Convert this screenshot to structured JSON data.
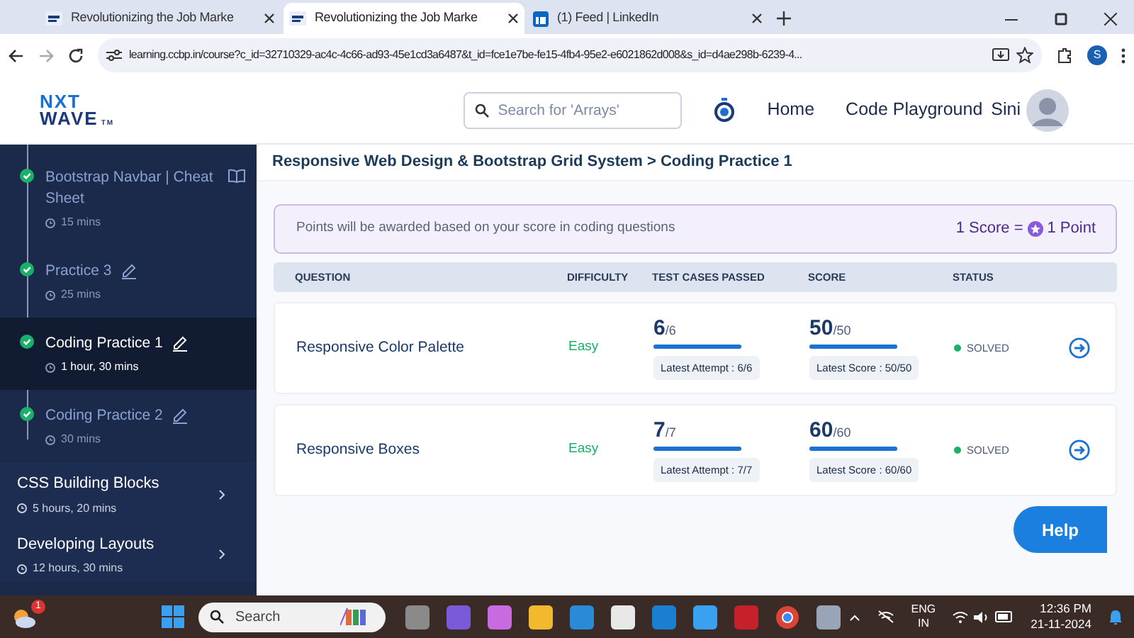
{
  "browser": {
    "tabs": [
      {
        "title": "Revolutionizing the Job Marke",
        "selected": false
      },
      {
        "title": "Revolutionizing the Job Marke",
        "selected": true
      },
      {
        "title": "(1) Feed | LinkedIn",
        "selected": false
      }
    ],
    "url": "learning.ccbp.in/course?c_id=32710329-ac4c-4c66-ad93-45e1cd3a6487&t_id=fce1e7be-fe15-4fb4-95e2-e6021862d008&s_id=d4ae298b-6239-4...",
    "profile": "S"
  },
  "header": {
    "logo": [
      "NXT",
      "WAVE",
      "TM"
    ],
    "search": {
      "placeholder": "Search for 'Arrays'"
    },
    "nav": [
      "Home",
      "Code Playground"
    ],
    "user": "Sini"
  },
  "sidebar": {
    "lessons": [
      {
        "title": "Bootstrap Navbar | Cheat Sheet",
        "duration": "15 mins",
        "kind": "reading",
        "completed": true,
        "selected": false
      },
      {
        "title": "Practice 3",
        "duration": "25 mins",
        "kind": "practice",
        "completed": true,
        "selected": false
      },
      {
        "title": "Coding Practice 1",
        "duration": "1 hour, 30 mins",
        "kind": "practice",
        "completed": true,
        "selected": true
      },
      {
        "title": "Coding Practice 2",
        "duration": "30 mins",
        "kind": "practice",
        "completed": true,
        "selected": false
      }
    ],
    "modules": [
      {
        "title": "CSS Building Blocks",
        "duration": "5 hours, 20 mins"
      },
      {
        "title": "Developing Layouts",
        "duration": "12 hours, 30 mins"
      }
    ]
  },
  "breadcrumb": "Responsive Web Design & Bootstrap Grid System > Coding Practice 1",
  "notice": {
    "text": "Points will be awarded based on your score in coding questions",
    "left": "1 Score =",
    "right": "1 Point"
  },
  "table": {
    "columns": [
      "QUESTION",
      "DIFFICULTY",
      "TEST CASES PASSED",
      "SCORE",
      "STATUS"
    ],
    "rows": [
      {
        "question": "Responsive Color Palette",
        "difficulty": "Easy",
        "passed": "6",
        "total": "/6",
        "passed_bar": {
          "level": 1
        },
        "attempt": "Latest Attempt : 6/6",
        "score": "50",
        "max": "/50",
        "score_bar": {
          "level": 1
        },
        "latest": "Latest Score : 50/50",
        "status": "SOLVED"
      },
      {
        "question": "Responsive Boxes",
        "difficulty": "Easy",
        "passed": "7",
        "total": "/7",
        "passed_bar": {
          "level": 1
        },
        "attempt": "Latest Attempt : 7/7",
        "score": "60",
        "max": "/60",
        "score_bar": {
          "level": 1
        },
        "latest": "Latest Score : 60/60",
        "status": "SOLVED"
      }
    ]
  },
  "help": "Help",
  "taskbar": {
    "weather_badge": "1",
    "search": "Search",
    "lang": [
      "ENG",
      "IN"
    ],
    "time": "12:36 PM",
    "date": "21-11-2024"
  }
}
